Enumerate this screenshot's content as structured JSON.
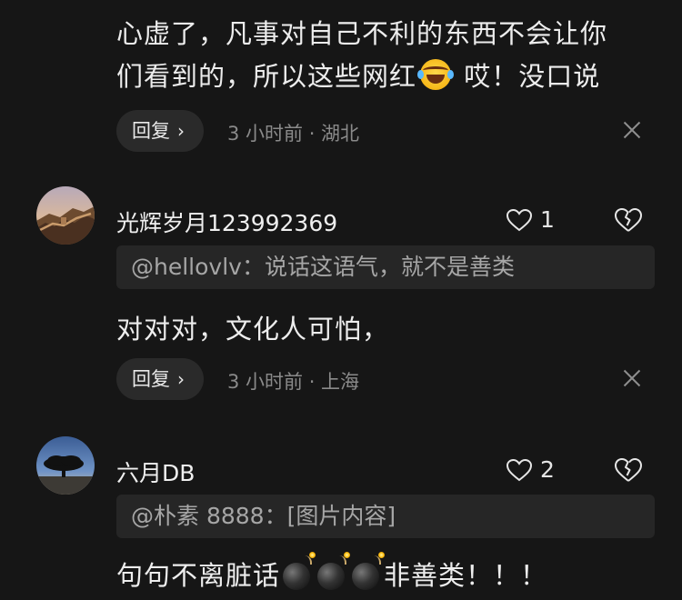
{
  "comments": [
    {
      "text_part1": "心虚了，凡事对自己不利的东西不会让你",
      "text_part2": "们看到的，所以这些网红",
      "emoji_icon": "laughing-crying-face-icon",
      "text_part3": " 哎！没口说",
      "reply_label": "回复",
      "meta": "3 小时前 · 湖北"
    },
    {
      "username": "光辉岁月123992369",
      "likes": "1",
      "quote": "@hellovlv：说话这语气，就不是善类",
      "text": "对对对，文化人可怕，",
      "reply_label": "回复",
      "meta": "3 小时前 · 上海"
    },
    {
      "username": "六月DB",
      "likes": "2",
      "quote": "@朴素 8888：[图片内容]",
      "text_part1": "句句不离脏话",
      "bomb_icon": "bomb-icon",
      "text_part2": "非善类！！！"
    }
  ],
  "colors": {
    "background": "#161616",
    "pill": "#2a2a2a",
    "quote_bg": "#262626",
    "meta_text": "#8a8a8a"
  }
}
